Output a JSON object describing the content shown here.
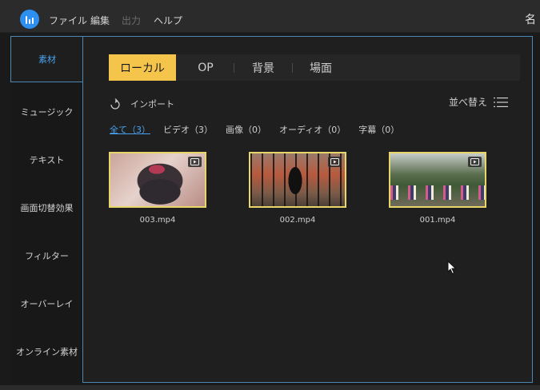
{
  "menubar": {
    "items": [
      "ファイル",
      "編集",
      "出力",
      "ヘルプ"
    ],
    "project_name": "名"
  },
  "sidebar": {
    "items": [
      {
        "label": "素材",
        "active": true
      },
      {
        "label": "ミュージック"
      },
      {
        "label": "テキスト"
      },
      {
        "label": "画面切替効果"
      },
      {
        "label": "フィルター"
      },
      {
        "label": "オーバーレイ"
      },
      {
        "label": "オンライン素材"
      }
    ]
  },
  "tabs": [
    "ローカル",
    "OP",
    "背景",
    "場面"
  ],
  "toolbar": {
    "import_label": "インポート",
    "sort_label": "並べ替え"
  },
  "filters": [
    "全て（3）",
    "ビデオ（3）",
    "画像（0）",
    "オーディオ（0）",
    "字幕（0）"
  ],
  "clips": [
    {
      "name": "003.mp4"
    },
    {
      "name": "002.mp4"
    },
    {
      "name": "001.mp4"
    }
  ],
  "colors": {
    "accent_blue": "#4aa3f0",
    "tab_active": "#f4c54a",
    "selection_border": "#e8d66a"
  }
}
